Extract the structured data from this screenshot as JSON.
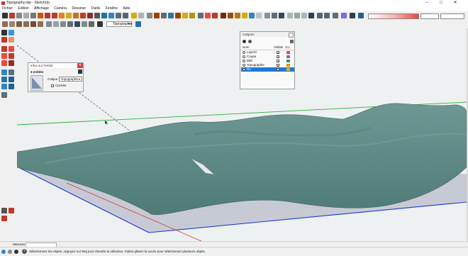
{
  "window": {
    "title": "Topography.skp - SketchUp",
    "controls": [
      "–",
      "□",
      "✕"
    ]
  },
  "menu": [
    "Fichier",
    "Edition",
    "Affichage",
    "Caméra",
    "Dessiner",
    "Outils",
    "Fenêtre",
    "Aide"
  ],
  "toolbar": {
    "layer_select": "Topographie"
  },
  "entity_info": {
    "title": "Infos sur l'entité",
    "count": "3 entités",
    "layer_label": "Calque :",
    "layer_value": "Topographie",
    "hidden_label": "Cachée"
  },
  "layers_panel": {
    "title": "Calques",
    "col_name": "Nom",
    "col_visible": "Visible",
    "col_color": "Co...",
    "rows": [
      {
        "name": "Layer0",
        "color": "#e24a4a",
        "visible": true,
        "selected": false
      },
      {
        "name": "Coupe",
        "color": "#9b59d0",
        "visible": true,
        "selected": false
      },
      {
        "name": "Bâti",
        "color": "#2e9e4f",
        "visible": true,
        "selected": false
      },
      {
        "name": "Topographie",
        "color": "#e08a1a",
        "visible": true,
        "selected": false
      },
      {
        "name": "Ro",
        "color": "#d9b21c",
        "visible": true,
        "selected": true
      }
    ]
  },
  "status": {
    "measure_label": "Mesures",
    "hint": "Sélectionnez les objets. Appuyez sur Maj pour étendre la sélection. Faites glisser la souris pour sélectionner plusieurs objets."
  },
  "colors": {
    "terrain": "#5f8a85",
    "ground": "#c9ccd5",
    "axis_blue": "#1a3ad6",
    "axis_red": "#d63a3a",
    "axis_green": "#2fae3a"
  }
}
